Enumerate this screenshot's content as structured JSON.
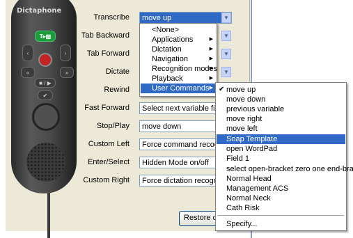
{
  "device": {
    "brand": "Dictaphone",
    "buttons": {
      "top_green": "T▸▥",
      "record": "",
      "play_stop": "■ / ▶",
      "check": "✔"
    }
  },
  "labels": {
    "transcribe": "Transcribe",
    "tab_backward": "Tab Backward",
    "tab_forward": "Tab Forward",
    "dictate": "Dictate",
    "rewind": "Rewind",
    "fast_forward": "Fast Forward",
    "stop_play": "Stop/Play",
    "custom_left": "Custom Left",
    "enter_select": "Enter/Select",
    "custom_right": "Custom Right"
  },
  "fields": {
    "transcribe": "move up",
    "fast_forward": "Select next variable field",
    "stop_play": "move down",
    "custom_left": "Force command recognition",
    "enter_select": "Hidden Mode on/off",
    "custom_right": "Force dictation recognition"
  },
  "restore_button": "Restore defaults",
  "menu": {
    "items": [
      "<None>",
      "Applications",
      "Dictation",
      "Navigation",
      "Recognition modes",
      "Playback",
      "User Commands"
    ],
    "highlighted": "User Commands"
  },
  "submenu": {
    "items": [
      "move up",
      "move down",
      "previous variable",
      "move right",
      "move left",
      "Soap Template",
      "open WordPad",
      "Field 1",
      "select open-bracket zero one end-bracket",
      "Normal Head",
      "Management ACS",
      "Normal Neck",
      "Cath Risk"
    ],
    "specify": "Specify...",
    "checked": "move up",
    "highlighted": "Soap Template"
  },
  "icons": {
    "dropdown_arrow": "chevron-down-icon",
    "submenu_arrow": "triangle-right-icon",
    "check": "checkmark-icon"
  },
  "colors": {
    "selection": "#316ac5",
    "dialog_bg": "#ece9d8",
    "combo_button": "#c6d3f7"
  }
}
